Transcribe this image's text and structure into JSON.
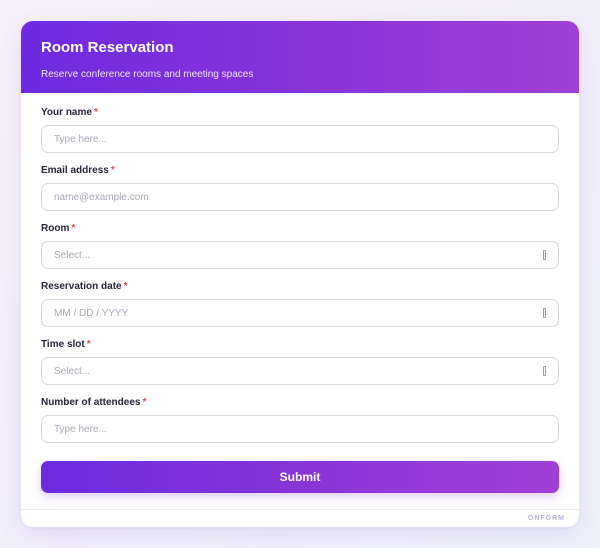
{
  "form": {
    "title": "Room Reservation",
    "subtitle": "Reserve conference rooms and meeting spaces",
    "required_mark": "*",
    "fields": [
      {
        "label": "Your name",
        "placeholder": "Type here...",
        "type": "text"
      },
      {
        "label": "Email address",
        "placeholder": "name@example.com",
        "type": "email"
      },
      {
        "label": "Room",
        "placeholder": "Select...",
        "type": "select"
      },
      {
        "label": "Reservation date",
        "placeholder": "MM / DD / YYYY",
        "type": "date"
      },
      {
        "label": "Time slot",
        "placeholder": "Select...",
        "type": "select"
      },
      {
        "label": "Number of attendees",
        "placeholder": "Type here...",
        "type": "number"
      }
    ],
    "submit_label": "Submit"
  },
  "footer": {
    "brand": "ONFORM"
  },
  "colors": {
    "header_gradient_start": "#6d2ae0",
    "header_gradient_end": "#a040d6",
    "required": "#e5484d"
  }
}
